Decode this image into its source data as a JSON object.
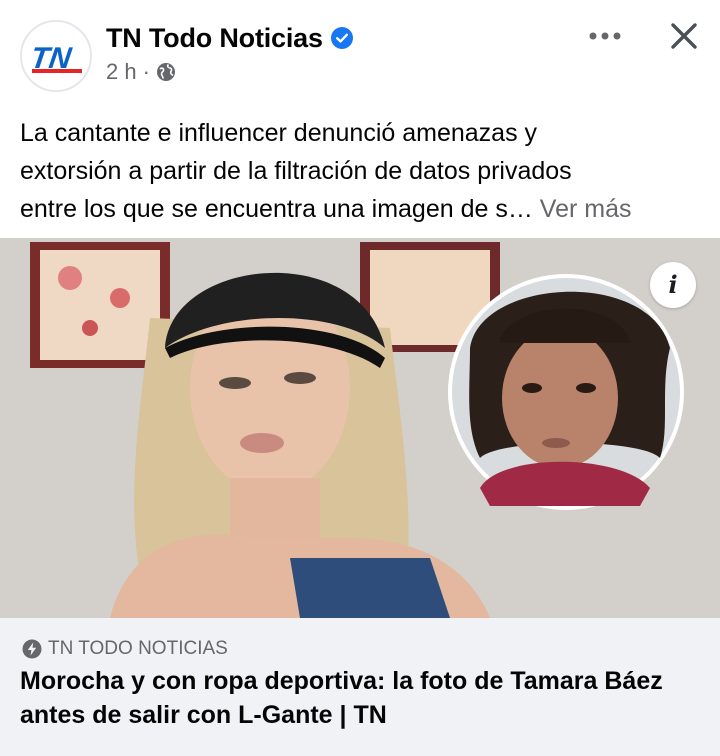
{
  "post": {
    "page_name": "TN Todo Noticias",
    "logo_text": "TN",
    "time": "2 h",
    "separator": "·",
    "text_lines": [
      "La cantante e influencer denunció amenazas y",
      "extorsión a partir de la filtración de datos privados",
      "entre los que se encuentra una imagen de s…"
    ],
    "see_more": "Ver más"
  },
  "icons": {
    "verified": "verified-badge-icon",
    "audience": "globe-icon",
    "more": "more-dots-icon",
    "close": "close-icon",
    "info": "info-icon",
    "source": "instant-bolt-icon"
  },
  "link": {
    "source": "TN TODO NOTICIAS",
    "title_lines": [
      "Morocha y con ropa deportiva: la foto de Tamara Báez",
      "antes de salir con L-Gante | TN"
    ],
    "info_glyph": "i"
  },
  "colors": {
    "brand_blue": "#1877f2",
    "tn_red": "#e4262b",
    "tn_blue": "#0a63c9",
    "secondary_text": "#65676b",
    "footer_bg": "#f0f2f5"
  }
}
